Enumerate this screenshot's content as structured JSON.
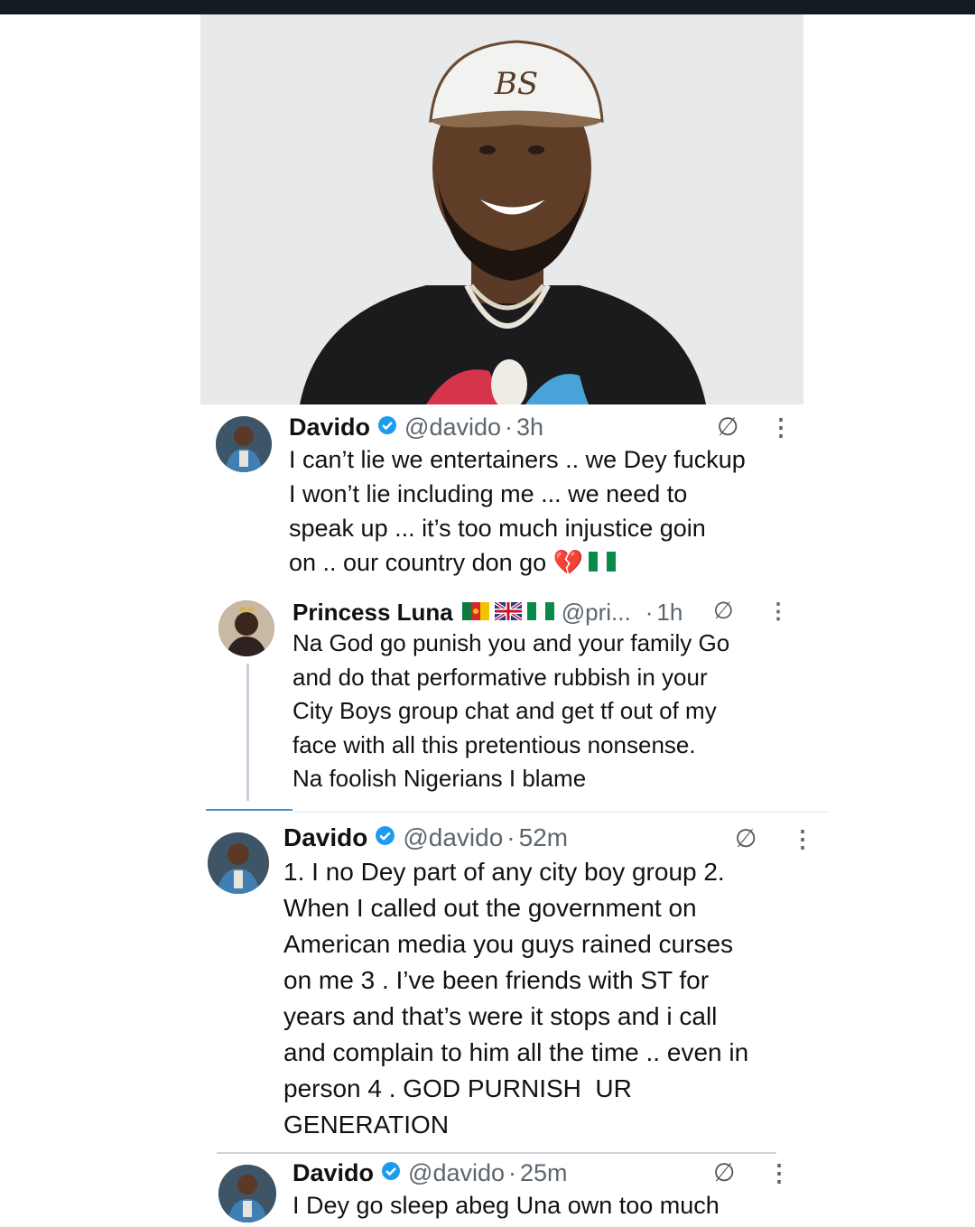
{
  "photo": {
    "cap_logo": "BS"
  },
  "tweets": [
    {
      "name": "Davido",
      "handle": "@davido",
      "sep": "·",
      "time": "3h",
      "lines": [
        "I can’t lie we entertainers .. we Dey fuckup",
        "I won’t lie including me ... we need to",
        "speak up ... it’s too much injustice goin",
        "on .. our country don go 💔"
      ]
    },
    {
      "name": "Princess Luna",
      "handle": "@pri...",
      "sep": "·",
      "time": "1h",
      "lines": [
        "Na God go punish you and your family Go",
        "and do that performative rubbish in your",
        "City Boys group chat and get tf out of my",
        "face with all this pretentious nonsense.",
        "Na foolish Nigerians I blame"
      ]
    },
    {
      "name": "Davido",
      "handle": "@davido",
      "sep": "·",
      "time": "52m",
      "lines": [
        "1. I no Dey part of any city boy group 2.",
        "When I called out the government on",
        "American media you guys rained curses",
        "on me 3 . I’ve been friends with ST for",
        "years and that’s were it stops and i call",
        "and complain to him all the time .. even in",
        "person 4 . GOD PURNISH  UR",
        "GENERATION"
      ]
    },
    {
      "name": "Davido",
      "handle": "@davido",
      "sep": "·",
      "time": "25m",
      "lines": [
        "I Dey go sleep abeg Una own too much"
      ]
    }
  ],
  "icons": {
    "grok": "∅",
    "more": "⋮"
  },
  "colors": {
    "verified": "#1d9bf0",
    "muted": "#5c6670",
    "thread": "#c9d2db"
  }
}
